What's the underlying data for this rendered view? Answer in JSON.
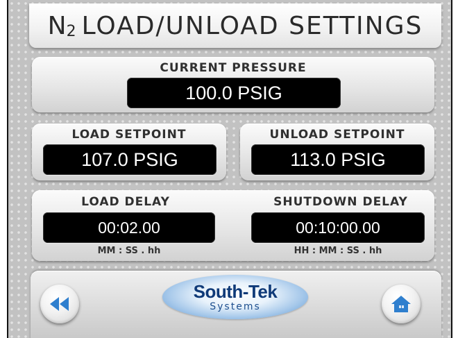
{
  "title": {
    "prefix": "N",
    "subscript": "2",
    "text": "LOAD/UNLOAD SETTINGS"
  },
  "current_pressure": {
    "label": "CURRENT PRESSURE",
    "value": "100.0 PSIG"
  },
  "load_setpoint": {
    "label": "LOAD SETPOINT",
    "value": "107.0 PSIG"
  },
  "unload_setpoint": {
    "label": "UNLOAD SETPOINT",
    "value": "113.0 PSIG"
  },
  "load_delay": {
    "label": "LOAD DELAY",
    "value": "00:02.00",
    "format": "MM : SS . hh"
  },
  "shutdown_delay": {
    "label": "SHUTDOWN DELAY",
    "value": "00:10:00.00",
    "format": "HH : MM : SS . hh"
  },
  "nav": {
    "back_icon": "rewind-icon",
    "home_icon": "home-icon",
    "logo_main": "South-Tek",
    "logo_sub": "Systems"
  },
  "colors": {
    "icon_blue": "#2f7fce",
    "display_bg": "#000000",
    "display_text": "#ffffff"
  }
}
